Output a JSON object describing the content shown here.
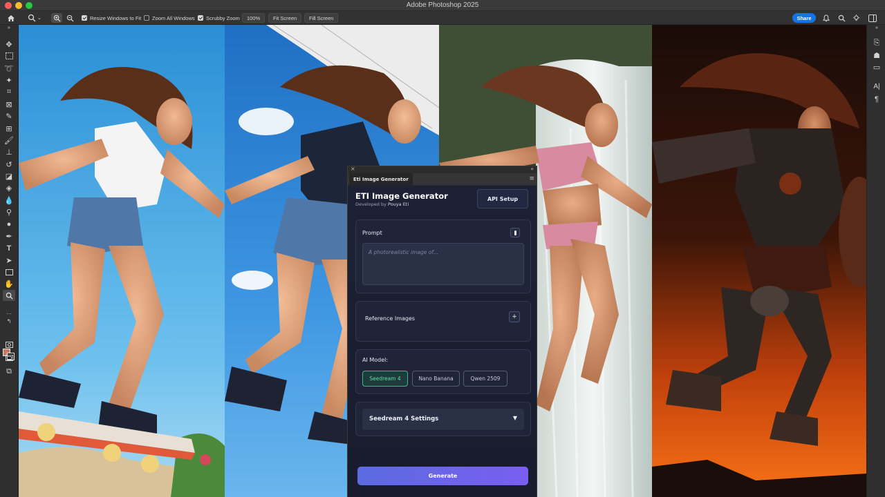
{
  "window": {
    "title": "Adobe Photoshop 2025"
  },
  "options_bar": {
    "resize_windows_label": "Resize Windows to Fit",
    "zoom_all_label": "Zoom All Windows",
    "scrubby_zoom_label": "Scrubby Zoom",
    "zoom_value": "100%",
    "fit_screen_label": "Fit Screen",
    "fill_screen_label": "Fill Screen",
    "share_label": "Share"
  },
  "swatches": {
    "foreground": "#c77a64",
    "background": "#111111"
  },
  "plugin": {
    "tab_label": "Eti Image Generator",
    "title": "ETI Image Generator",
    "subtitle_prefix": "Developed by",
    "subtitle_author": "Pouya Eti",
    "api_setup_label": "API Setup",
    "prompt_label": "Prompt",
    "prompt_placeholder": "A photorealistic image of...",
    "reference_images_label": "Reference Images",
    "add_symbol": "+",
    "ai_model_label": "AI Model:",
    "models": [
      "Seedream 4",
      "Nano Banana",
      "Qwen 2509"
    ],
    "selected_model": "Seedream 4",
    "settings_label": "Seedream 4 Settings",
    "caret": "▼",
    "generate_label": "Generate",
    "accent_color": "#3fb985",
    "generate_gradient": [
      "#5b6be0",
      "#7a5ef0"
    ]
  },
  "icons": {
    "home": "home-icon",
    "zoom": "zoom-icon",
    "bell": "bell-icon",
    "search": "search-icon",
    "lightbulb": "lightbulb-icon",
    "panel_toggle": "panel-toggle-icon"
  }
}
